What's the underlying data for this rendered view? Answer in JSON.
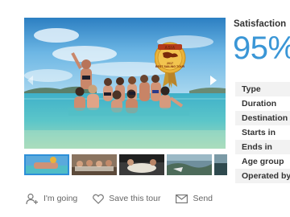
{
  "gallery": {
    "badge": {
      "top": "ASIA",
      "line1": "2017",
      "line2": "BEST SAILING TOUR"
    },
    "thumbnails": [
      "beach-group",
      "group-sitting",
      "boat-dining",
      "coastline",
      "sea-view"
    ],
    "active_thumbnail": 0
  },
  "actions": {
    "going_label": "I'm going",
    "save_label": "Save this tour",
    "send_label": "Send"
  },
  "satisfaction": {
    "title": "Satisfaction",
    "value": "95%"
  },
  "details": [
    {
      "label": "Type"
    },
    {
      "label": "Duration"
    },
    {
      "label": "Destination"
    },
    {
      "label": "Starts in"
    },
    {
      "label": "Ends in"
    },
    {
      "label": "Age group"
    },
    {
      "label": "Operated by"
    }
  ],
  "colors": {
    "accent": "#3a96d6",
    "thumb_border": "#2e8fd8"
  }
}
